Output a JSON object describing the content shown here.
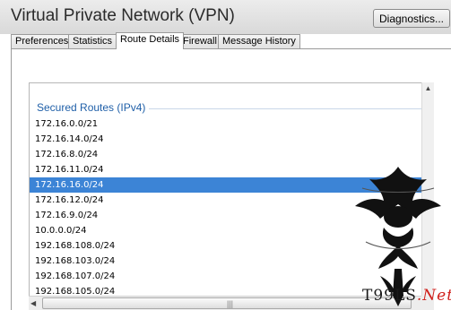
{
  "window": {
    "title": "Virtual Private Network (VPN)"
  },
  "toolbar": {
    "diagnostics_label": "Diagnostics..."
  },
  "tabs": [
    {
      "label": "Preferences",
      "active": false
    },
    {
      "label": "Statistics",
      "active": false
    },
    {
      "label": "Route Details",
      "active": true
    },
    {
      "label": "Firewall",
      "active": false
    },
    {
      "label": "Message History",
      "active": false
    }
  ],
  "routes": {
    "group_title": "Secured Routes (IPv4)",
    "items": [
      {
        "address": "172.16.0.0/21",
        "selected": false
      },
      {
        "address": "172.16.14.0/24",
        "selected": false
      },
      {
        "address": "172.16.8.0/24",
        "selected": false
      },
      {
        "address": "172.16.11.0/24",
        "selected": false
      },
      {
        "address": "172.16.16.0/24",
        "selected": true
      },
      {
        "address": "172.16.12.0/24",
        "selected": false
      },
      {
        "address": "172.16.9.0/24",
        "selected": false
      },
      {
        "address": "10.0.0.0/24",
        "selected": false
      },
      {
        "address": "192.168.108.0/24",
        "selected": false
      },
      {
        "address": "192.168.103.0/24",
        "selected": false
      },
      {
        "address": "192.168.107.0/24",
        "selected": false
      },
      {
        "address": "192.168.105.0/24",
        "selected": false
      }
    ]
  },
  "colors": {
    "selection": "#3c84d6",
    "group_title": "#1f5fa8",
    "watermark_accent": "#d0201b"
  },
  "watermark": {
    "text_main": "T99LS",
    "text_accent": ".Net"
  },
  "icons": {
    "scroll_up": "chevron-up-icon",
    "scroll_left": "chevron-left-icon",
    "grip": "grip-icon",
    "watermark": "dragon-logo-icon"
  }
}
